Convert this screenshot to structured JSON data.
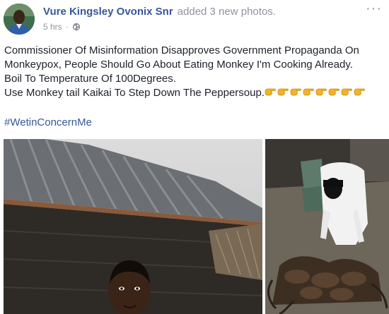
{
  "post": {
    "author": "Vure Kingsley Ovonix Snr",
    "action": "added 3 new photos.",
    "timestamp": "5 hrs",
    "separator": "·",
    "privacy_icon": "globe-icon",
    "options_label": "···",
    "text_lines": [
      "Commissioner Of Misinformation Disapproves Government Propaganda On",
      "Monkeypox, People Should Go About Eating Monkey I'm Cooking Already.",
      "Boil To Temperature Of 100Degrees.",
      "Use Monkey tail Kaikai To Step Down The Peppersoup."
    ],
    "emoji": "hand-pointing-icon",
    "emoji_count": 8,
    "hashtag": "#WetinConcernMe",
    "photos": [
      {
        "icon": "photo-man-under-roof"
      },
      {
        "icon": "photo-man-with-monkeys"
      }
    ]
  },
  "colors": {
    "link": "#365899",
    "text": "#1d2129",
    "muted": "#90949c",
    "emoji": "#f0b429"
  }
}
